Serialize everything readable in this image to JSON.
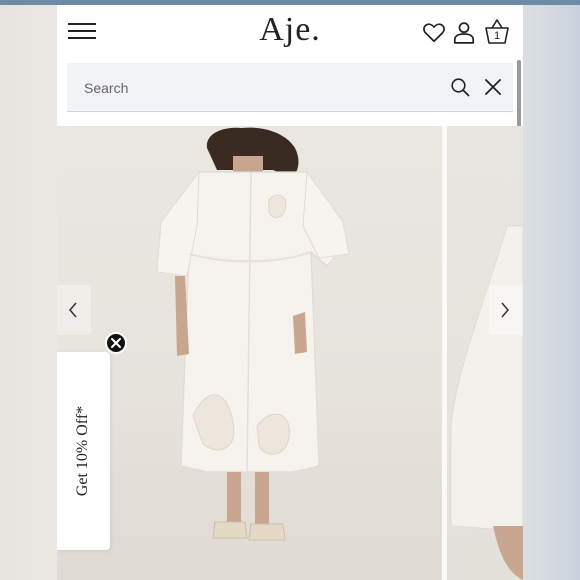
{
  "header": {
    "logo": "Aje.",
    "cart_count": "1"
  },
  "search": {
    "placeholder": "Search",
    "value": ""
  },
  "promo": {
    "label": "Get 10% Off*"
  },
  "icons": {
    "menu": "hamburger-menu-icon",
    "wishlist": "heart-icon",
    "account": "user-icon",
    "cart": "basket-icon",
    "search": "search-icon",
    "close": "close-icon",
    "prev": "chevron-left-icon",
    "next": "chevron-right-icon"
  },
  "colors": {
    "text": "#222222",
    "search_bg": "#f1f3f6",
    "photo_bg": "#e9e5e0",
    "promo_close": "#111111"
  }
}
